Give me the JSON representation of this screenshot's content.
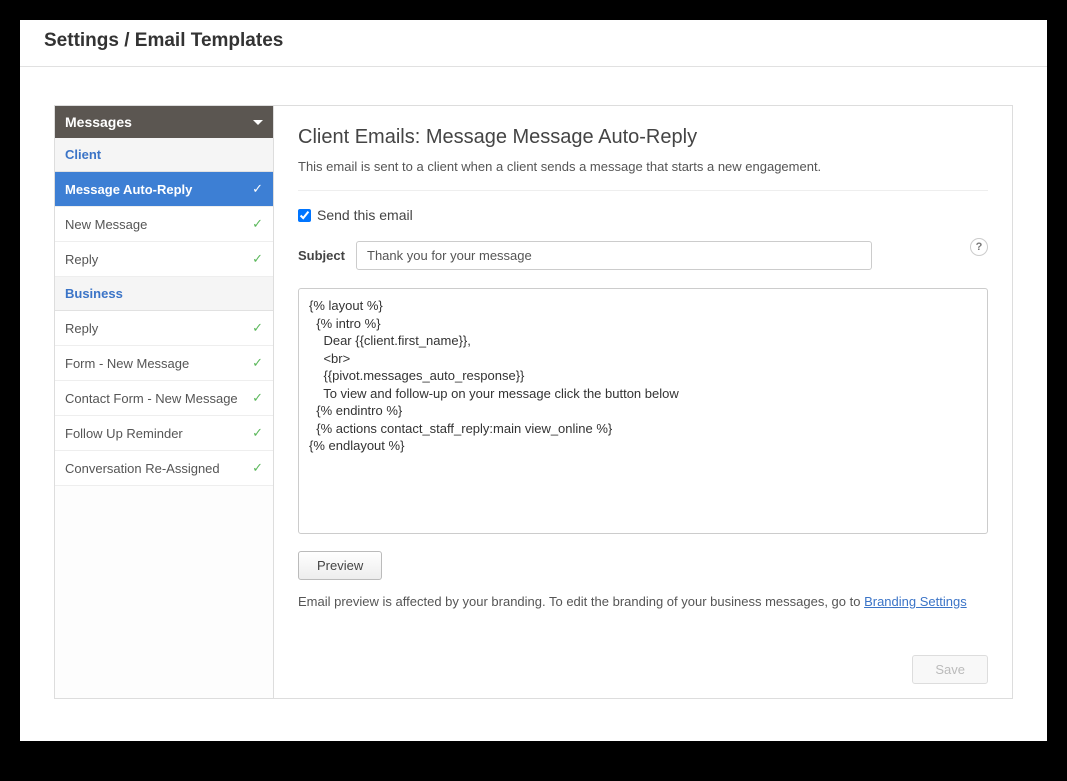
{
  "page_title": "Settings / Email Templates",
  "sidebar": {
    "header": "Messages",
    "sections": [
      {
        "title": "Client",
        "items": [
          {
            "label": "Message Auto-Reply",
            "active": true
          },
          {
            "label": "New Message"
          },
          {
            "label": "Reply"
          }
        ]
      },
      {
        "title": "Business",
        "items": [
          {
            "label": "Reply"
          },
          {
            "label": "Form - New Message"
          },
          {
            "label": "Contact Form - New Message"
          },
          {
            "label": "Follow Up Reminder"
          },
          {
            "label": "Conversation Re-Assigned"
          }
        ]
      }
    ]
  },
  "main": {
    "title": "Client Emails: Message Message Auto-Reply",
    "description": "This email is sent to a client when a client sends a message that starts a new engagement.",
    "send_checkbox_label": "Send this email",
    "send_checked": true,
    "subject_label": "Subject",
    "subject_value": "Thank you for your message",
    "help_icon": "?",
    "body": "{% layout %}\n  {% intro %}\n    Dear {{client.first_name}},\n    <br>\n    {{pivot.messages_auto_response}}\n    To view and follow-up on your message click the button below\n  {% endintro %}\n  {% actions contact_staff_reply:main view_online %}\n{% endlayout %}",
    "preview_button": "Preview",
    "note_prefix": "Email preview is affected by your branding. To edit the branding of your business messages, go to ",
    "note_link": "Branding Settings",
    "save_button": "Save"
  }
}
